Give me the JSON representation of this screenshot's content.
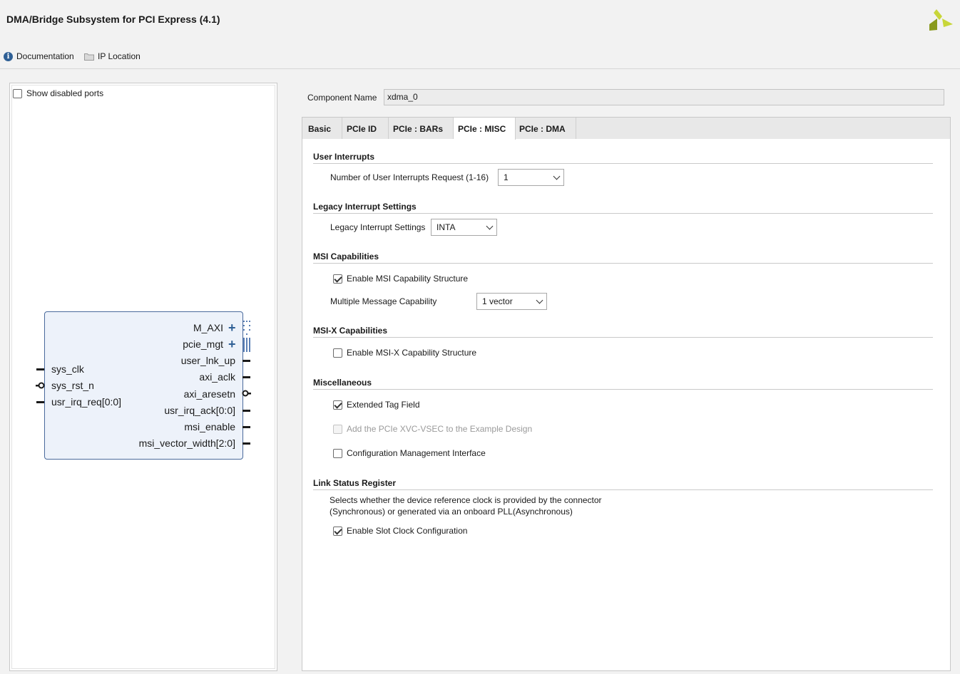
{
  "window": {
    "title": "DMA/Bridge Subsystem for PCI Express (4.1)"
  },
  "toolbar": {
    "documentation": "Documentation",
    "ip_location": "IP Location",
    "icons": [
      "info-icon",
      "folder-icon"
    ]
  },
  "left_panel": {
    "show_disabled_ports": {
      "label": "Show disabled ports",
      "checked": false
    },
    "block": {
      "left_ports": [
        "sys_clk",
        "sys_rst_n",
        "usr_irq_req[0:0]"
      ],
      "right_ports": [
        "M_AXI",
        "pcie_mgt",
        "user_lnk_up",
        "axi_aclk",
        "axi_aresetn",
        "usr_irq_ack[0:0]",
        "msi_enable",
        "msi_vector_width[2:0]"
      ]
    }
  },
  "component": {
    "label": "Component Name",
    "value": "xdma_0"
  },
  "tabs": [
    {
      "label": "Basic",
      "active": false
    },
    {
      "label": "PCIe ID",
      "active": false
    },
    {
      "label": "PCIe : BARs",
      "active": false
    },
    {
      "label": "PCIe : MISC",
      "active": true
    },
    {
      "label": "PCIe : DMA",
      "active": false
    }
  ],
  "sections": {
    "user_interrupts": {
      "title": "User Interrupts",
      "num_label": "Number of User Interrupts Request (1-16)",
      "num_value": "1"
    },
    "legacy": {
      "title": "Legacy Interrupt Settings",
      "label": "Legacy Interrupt Settings",
      "value": "INTA"
    },
    "msi": {
      "title": "MSI Capabilities",
      "enable_label": "Enable MSI Capability Structure",
      "enable_checked": true,
      "mmc_label": "Multiple Message Capability",
      "mmc_value": "1 vector"
    },
    "msix": {
      "title": "MSI-X Capabilities",
      "enable_label": "Enable MSI-X Capability Structure",
      "enable_checked": false
    },
    "misc": {
      "title": "Miscellaneous",
      "ext_tag_label": "Extended Tag Field",
      "ext_tag_checked": true,
      "xvc_label": "Add the PCIe XVC-VSEC to the Example Design",
      "xvc_checked": false,
      "xvc_disabled": true,
      "cmi_label": "Configuration Management Interface",
      "cmi_checked": false
    },
    "link": {
      "title": "Link Status Register",
      "desc_line1": "Selects whether the device reference clock is provided by the connector",
      "desc_line2": "(Synchronous) or generated via an onboard PLL(Asynchronous)",
      "slot_label": "Enable Slot Clock Configuration",
      "slot_checked": true
    }
  },
  "colors": {
    "accent": "#2e5f95",
    "logo_light": "#c8d63a",
    "logo_dark": "#8a9a1e"
  }
}
